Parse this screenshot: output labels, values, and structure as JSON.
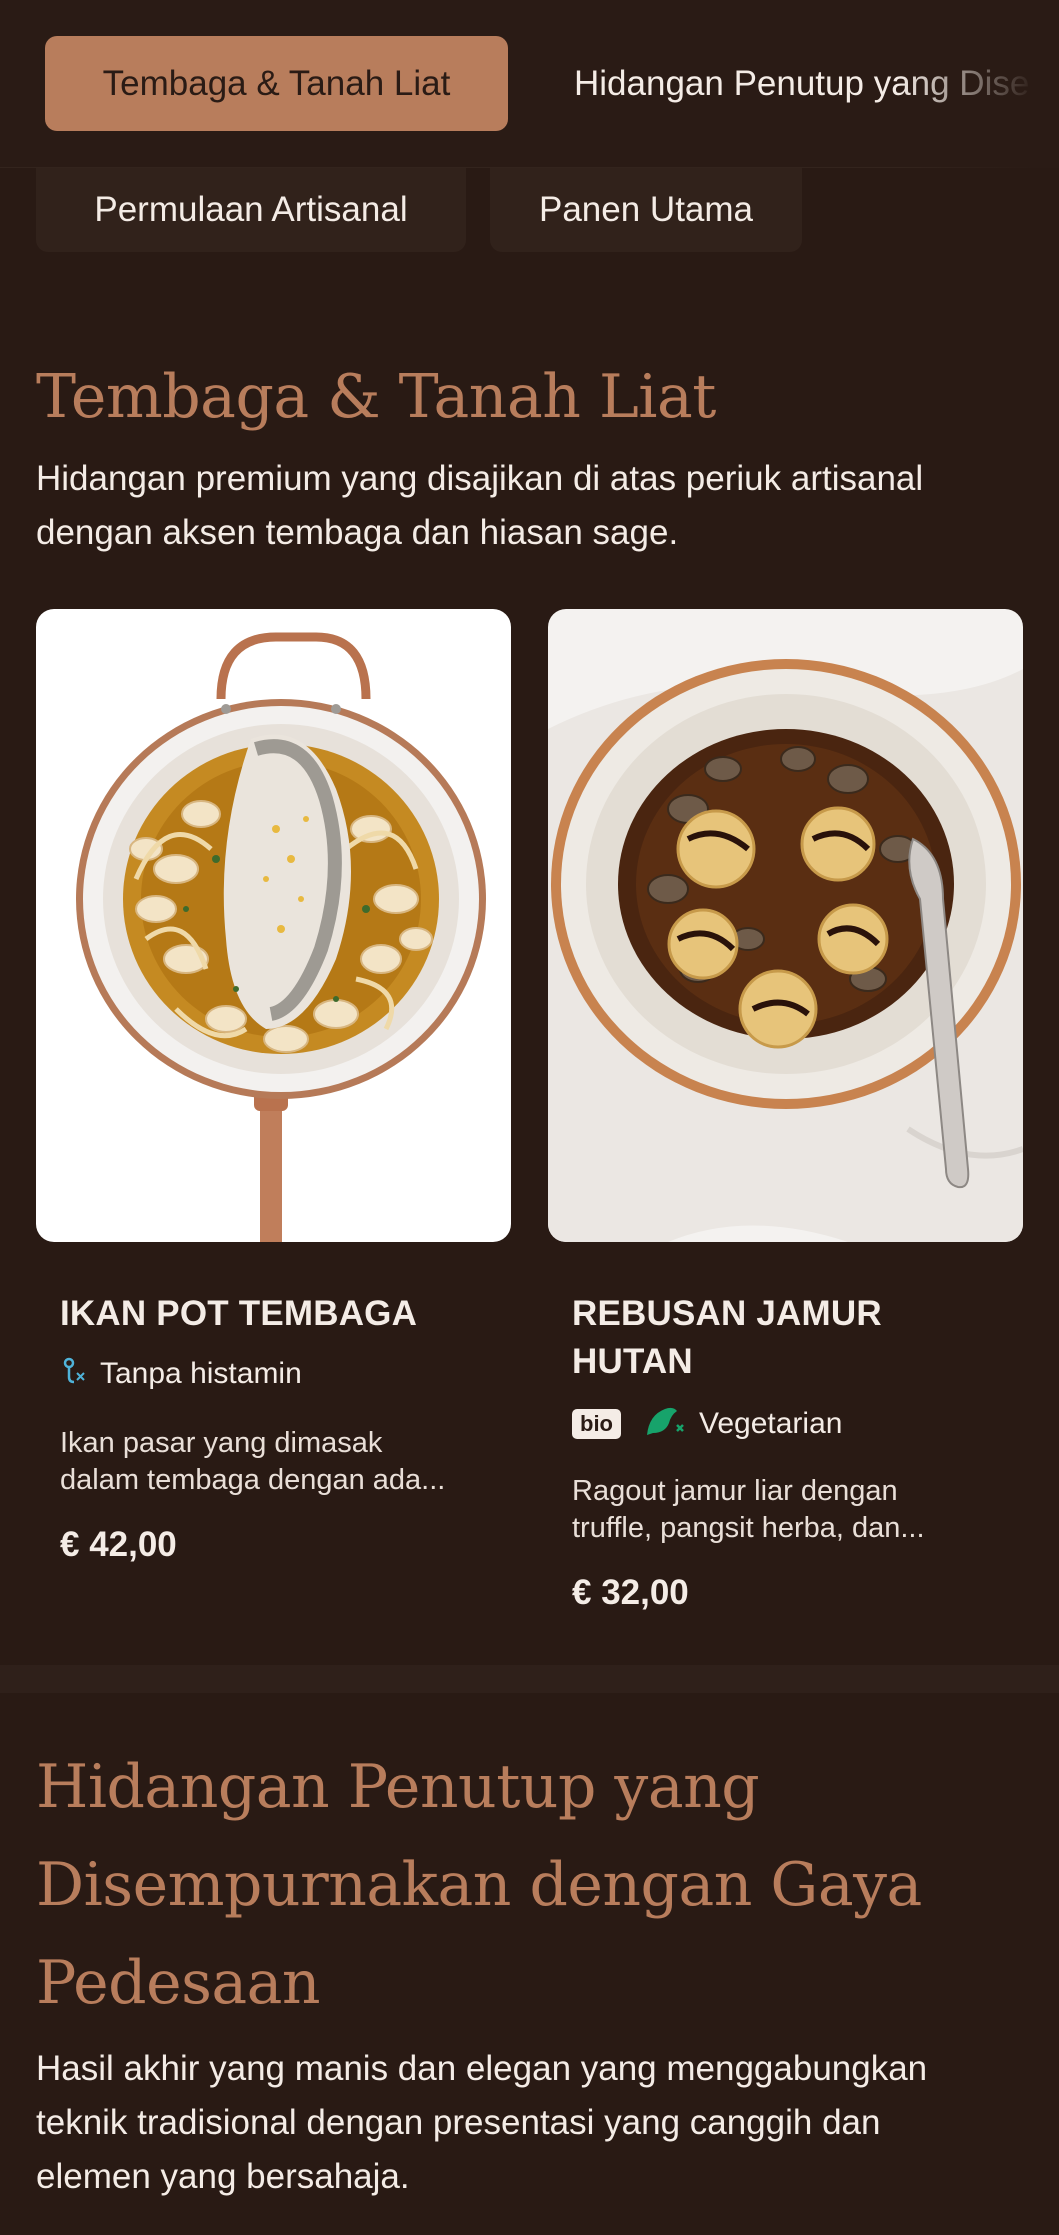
{
  "tabs": {
    "active": "Tembaga & Tanah Liat",
    "next": "Hidangan Penutup yang Dise",
    "chips": [
      "Permulaan Artisanal",
      "Panen Utama"
    ]
  },
  "section1": {
    "title": "Tembaga & Tanah Liat",
    "description": "Hidangan premium yang disajikan di atas periuk artisanal dengan aksen tembaga dan hiasan sage."
  },
  "dishes": [
    {
      "name": "IKAN POT TEMBAGA",
      "tags": [
        "Tanpa histamin"
      ],
      "description_line1": "Ikan pasar yang dimasak",
      "description_line2": "dalam tembaga dengan ada...",
      "price": "€ 42,00"
    },
    {
      "name_line1": "REBUSAN JAMUR",
      "name_line2": "HUTAN",
      "badge": "bio",
      "tags": [
        "Vegetarian"
      ],
      "description_line1": "Ragout jamur liar dengan",
      "description_line2": "truffle, pangsit herba, dan...",
      "price": "€ 32,00"
    }
  ],
  "section2": {
    "title_line1": "Hidangan Penutup yang",
    "title_line2": "Disempurnakan dengan Gaya",
    "title_line3": "Pedesaan",
    "description_line1": "Hasil akhir yang manis dan elegan yang menggabungkan",
    "description_line2": "teknik tradisional dengan presentasi yang canggih dan",
    "description_line3": "elemen yang bersahaja."
  },
  "colors": {
    "background": "#291a14",
    "accent": "#b87d5c",
    "text": "#f4ece6",
    "vegetarian_icon": "#17a36b",
    "histamine_icon": "#4fb3d9"
  },
  "icons": {
    "histamine": "histamine-free-icon",
    "vegetarian": "vegetarian-leaf-icon"
  }
}
